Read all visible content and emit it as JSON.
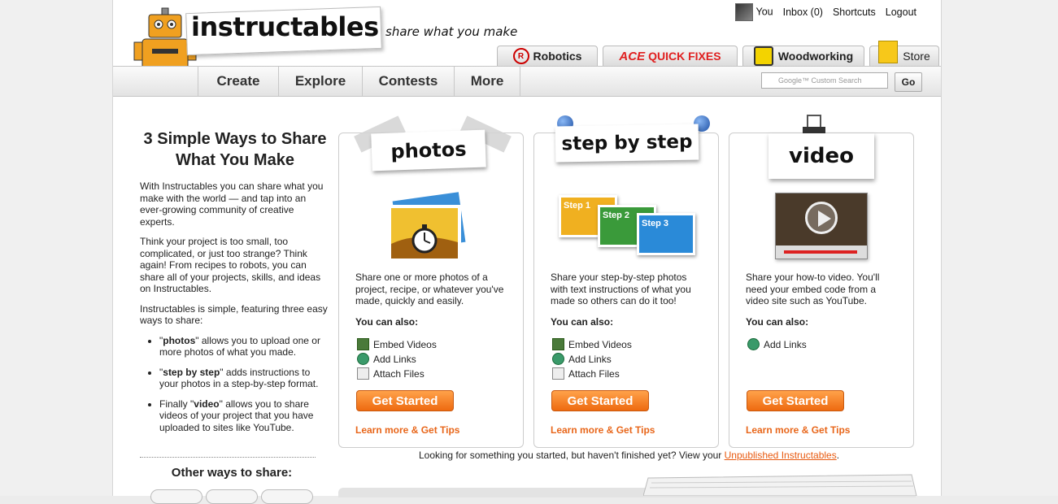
{
  "header": {
    "logo_text": "instructables",
    "tagline": "share what you make",
    "user_links": [
      "You",
      "Inbox (0)",
      "Shortcuts",
      "Logout"
    ]
  },
  "sponsor_tabs": {
    "robotics": "Robotics",
    "ace_brand": "ACE",
    "ace_label": "QUICK FIXES",
    "woodworking": "Woodworking",
    "store": "Store"
  },
  "nav": {
    "items": [
      "Create",
      "Explore",
      "Contests",
      "More"
    ],
    "search_placeholder": "Google™ Custom Search",
    "go_label": "Go"
  },
  "left": {
    "title": "3 Simple Ways to Share What You Make",
    "p1": "With Instructables you can share what you make with the world — and tap into an ever-growing community of creative experts.",
    "p2": "Think your project is too small, too complicated, or just too strange? Think again! From recipes to robots, you can share all of your projects, skills, and ideas on Instructables.",
    "p3": "Instructables is simple, featuring three easy ways to share:",
    "bullets": [
      {
        "pre": "\"",
        "bold": "photos",
        "post": "\" allows you to upload one or more photos of what you made."
      },
      {
        "pre": "\"",
        "bold": "step by step",
        "post": "\" adds instructions to your photos in a step-by-step format."
      },
      {
        "pre": "Finally \"",
        "bold": "video",
        "post": "\" allows you to share videos of your project that you have uploaded to sites like YouTube."
      }
    ],
    "other_ways": "Other ways to share:"
  },
  "cards": [
    {
      "title": "photos",
      "description": "Share one or more photos of a project, recipe, or whatever you've made, quickly and easily.",
      "also_label": "You can also:",
      "features": [
        "Embed Videos",
        "Add Links",
        "Attach Files"
      ],
      "button": "Get Started",
      "learn_more": "Learn more & Get Tips"
    },
    {
      "title": "step by step",
      "description": "Share your step-by-step photos with text instructions of what you made so others can do it too!",
      "also_label": "You can also:",
      "features": [
        "Embed Videos",
        "Add Links",
        "Attach Files"
      ],
      "button": "Get Started",
      "learn_more": "Learn more & Get Tips",
      "step_labels": [
        "Step 1",
        "Step 2",
        "Step 3"
      ]
    },
    {
      "title": "video",
      "description": "Share your how-to video. You'll need your embed code from a video site such as YouTube.",
      "also_label": "You can also:",
      "features": [
        "Add Links"
      ],
      "button": "Get Started",
      "learn_more": "Learn more & Get Tips"
    }
  ],
  "footer": {
    "text": "Looking for something you started, but haven't finished yet? View your ",
    "link": "Unpublished Instructables",
    "end": "."
  },
  "colors": {
    "accent": "#ee6a10",
    "link": "#e8661a"
  }
}
